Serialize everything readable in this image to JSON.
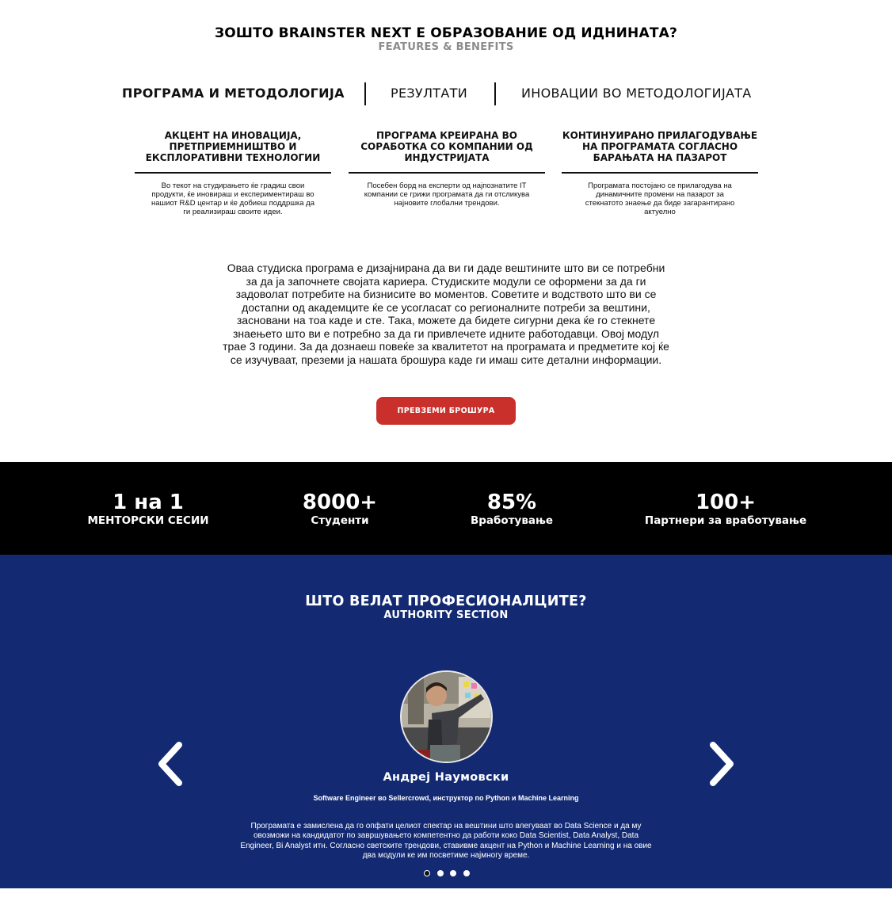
{
  "header": {
    "title": "ЗОШТО BRAINSTER NEXT Е ОБРАЗОВАНИЕ ОД ИДНИНАТА?",
    "subtitle": "FEATURES & BENEFITS"
  },
  "tabs": [
    {
      "label": "ПРОГРАМА И МЕТОДОЛОГИЈА",
      "active": true
    },
    {
      "label": "РЕЗУЛТАТИ",
      "active": false
    },
    {
      "label": "ИНОВАЦИИ ВО МЕТОДОЛОГИЈАТА",
      "active": false
    }
  ],
  "features": [
    {
      "title": "АКЦЕНТ НА ИНОВАЦИЈА, ПРЕТПРИЕМНИШТВО И ЕКСПЛОРАТИВНИ ТЕХНОЛОГИИ",
      "text": "Во текот на студирањето ќе градиш свои продукти, ќе иновираш и експериментираш во нашиот R&D центар и ќе добиеш поддршка да ги реализираш своите идеи."
    },
    {
      "title": "ПРОГРАМА КРЕИРАНА ВО СОРАБОТКА СО КОМПАНИИ ОД ИНДУСТРИЈАТА",
      "text": "Посебен борд на експерти од најпознатите IT компании се грижи програмата да ги отсликува најновите глобални трендови."
    },
    {
      "title": "КОНТИНУИРАНО ПРИЛАГОДУВАЊЕ НА ПРОГРАМАТА СОГЛАСНО БАРАЊАТА НА ПАЗАРОТ",
      "text": "Програмата постојано се прилагодува на динамичните промени на пазарот за стекнатото знаење да биде загарантирано актуелно"
    }
  ],
  "intro": {
    "text": "Оваа студиска програма е дизајнирана да ви ги даде вештините што ви се потребни за да ја започнете својата кариера. Студиските модули се оформени за да ги задоволат потребите на бизнисите во моментов. Советите и водството што ви се достапни од академците ќе се усогласат со регионалните потреби за вештини, засновани на тоа каде и сте. Така, можете да бидете сигурни дека ќе го стекнете знаењето што ви е потребно за да ги привлечете идните работодавци. Овој модул трае 3 години. За да дознаеш повеќе за квалитетот на програмата и предметите кој ќе се изучуваат, преземи ја нашата брошура каде ги имаш сите детални информации.",
    "cta_label": "ПРЕВЗЕМИ БРОШУРА"
  },
  "stats": [
    {
      "value": "1 на 1",
      "label": "МЕНТОРСКИ СЕСИИ"
    },
    {
      "value": "8000+",
      "label": "Студенти"
    },
    {
      "value": "85%",
      "label": "Вработување"
    },
    {
      "value": "100+",
      "label": "Партнери за вработување"
    }
  ],
  "authority": {
    "title": "ШТО ВЕЛАТ ПРОФЕСИОНАЛЦИТЕ?",
    "subtitle": "AUTHORITY SECTION",
    "person_name": "Андреј Наумовски",
    "person_role": "Software Engineer во Sellercrowd, инструктор по Python и Machine Learning",
    "quote": "Програмата е замислена да го опфати целиот спектар на вештини што влегуваат во Data Science и да му овозможи на кандидатот по завршувањето компетентно да работи коко Data Scientist, Data Analyst, Data Engineer, Bi Analyst итн. Согласно светските трендови, ставивме акцент на Python и Machine Learning и на овие два модули ке им посветиме најмногу време.",
    "slides_total": 4,
    "active_slide": 1
  },
  "colors": {
    "cta_red": "#c9302c",
    "stats_bg": "#000000",
    "authority_bg": "#132a73",
    "subtitle_gray": "#8c8c8c"
  }
}
